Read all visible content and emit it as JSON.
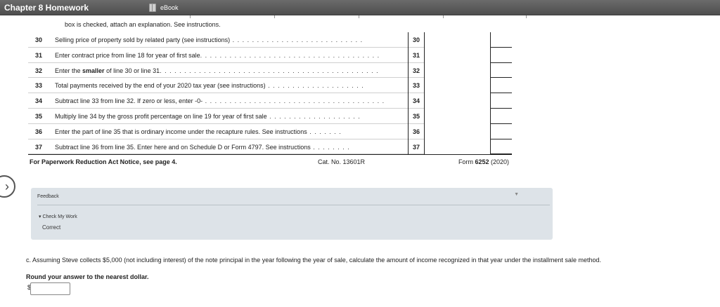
{
  "header": {
    "title": "Chapter 8 Homework",
    "ebook_label": "eBook"
  },
  "form": {
    "top_note": "box is checked, attach an explanation. See instructions.",
    "rows": [
      {
        "num": "30",
        "text_pre": "Selling price of property sold by related party (see instructions)",
        "text_bold": "",
        "text_post": "",
        "dots": " . . . . . . . . . . . . . . . . . . . . . . . . . . .",
        "box": "30"
      },
      {
        "num": "31",
        "text_pre": "Enter contract price from line 18 for year of first sale",
        "text_bold": "",
        "text_post": "",
        "dots": ". . . . . . . . . . . . . . . . . . . . . . . . . . . . . . . . . . . . .",
        "box": "31"
      },
      {
        "num": "32",
        "text_pre": "Enter the ",
        "text_bold": "smaller",
        "text_post": " of line 30 or line 31",
        "dots": ". . . . . . . . . . . . . . . . . . . . . . . . . . . . . . . . . . . . . . . . . . . . .",
        "box": "32"
      },
      {
        "num": "33",
        "text_pre": "Total payments received by the end of your 2020 tax year (see instructions)",
        "text_bold": "",
        "text_post": "",
        "dots": " . . . . . . . . . . . . . . . . . . . .",
        "box": "33"
      },
      {
        "num": "34",
        "text_pre": "Subtract line 33 from line 32. If zero or less, enter -0-",
        "text_bold": "",
        "text_post": "",
        "dots": " . . . . . . . . . . . . . . . . . . . . . . . . . . . . . . . . . . . . .",
        "box": "34"
      },
      {
        "num": "35",
        "text_pre": "Multiply line 34 by the gross profit percentage on line 19 for year of first sale",
        "text_bold": "",
        "text_post": "",
        "dots": " . . . . . . . . . . . . . . . . . . .",
        "box": "35"
      },
      {
        "num": "36",
        "text_pre": "Enter the part of line 35 that is ordinary income under the recapture rules. See instructions",
        "text_bold": "",
        "text_post": "",
        "dots": " . . . . . . .",
        "box": "36"
      },
      {
        "num": "37",
        "text_pre": "Subtract line 36 from line 35. Enter here and on Schedule D or Form 4797. See instructions",
        "text_bold": "",
        "text_post": "",
        "dots": " . . . . . . . .",
        "box": "37"
      }
    ],
    "footer": {
      "paperwork": "For Paperwork Reduction Act Notice, see page 4.",
      "cat_no": "Cat. No. 13601R",
      "form_prefix": "Form ",
      "form_number": "6252",
      "form_year": " (2020)"
    }
  },
  "feedback": {
    "title": "Feedback",
    "check_label": "Check My Work",
    "result": "Correct"
  },
  "question": {
    "text": "c. Assuming Steve collects $5,000 (not including interest) of the note principal in the year following the year of sale, calculate the amount of income recognized in that year under the installment sale method.",
    "round": "Round your answer to the nearest dollar.",
    "currency": "$",
    "answer_value": ""
  },
  "icons": {
    "page_arrow": "chevron-right-icon",
    "ebook": "book-icon",
    "caret": "caret-down-icon"
  }
}
